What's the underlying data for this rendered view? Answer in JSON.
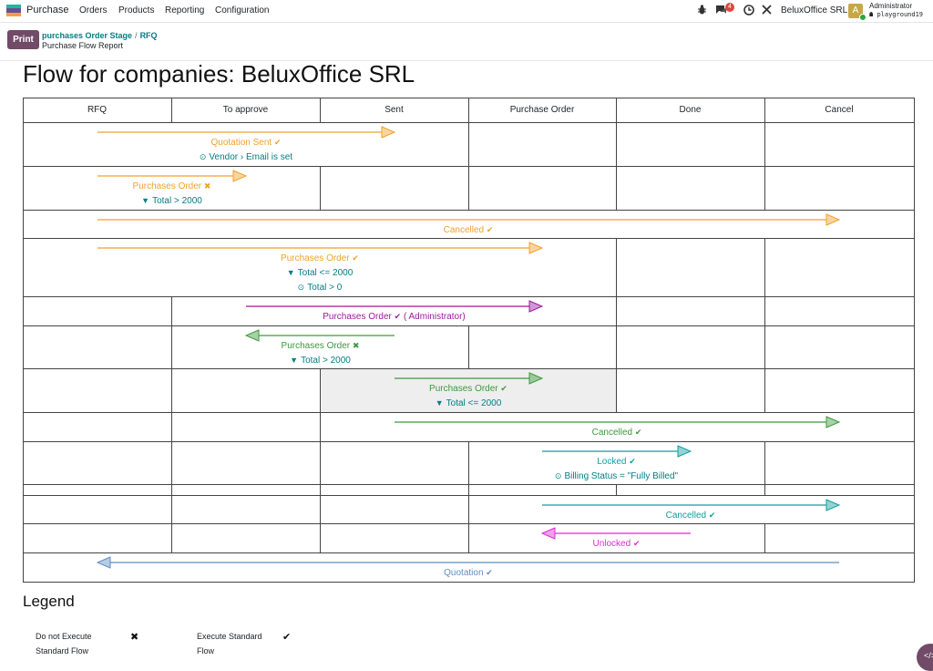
{
  "navbar": {
    "app_name": "Purchase",
    "menu": [
      "Orders",
      "Products",
      "Reporting",
      "Configuration"
    ],
    "message_count": "4",
    "company": "BeluxOffice SRL",
    "user_initial": "A",
    "user_name": "Administrator",
    "database": "playground19"
  },
  "control_panel": {
    "print_label": "Print",
    "breadcrumb": [
      "purchases Order Stage",
      "RFQ"
    ],
    "breadcrumb_sep": "/",
    "subtitle": "Purchase Flow Report"
  },
  "report": {
    "title": "Flow for companies: BeluxOffice SRL",
    "columns": [
      "RFQ",
      "To approve",
      "Sent",
      "Purchase Order",
      "Done",
      "Cancel"
    ],
    "colors": {
      "orange": "#f0a12b",
      "purple": "#9c1a9c",
      "green": "#3c9a3c",
      "teal": "#129e9e",
      "magenta": "#e028d8",
      "blue": "#5b8ec4",
      "cond": "#017e84"
    },
    "flows": [
      {
        "label": "Quotation Sent",
        "mark": "✔",
        "from": "RFQ",
        "to": "Sent",
        "color": "orange",
        "conditions": [
          "Vendor › Email is set"
        ],
        "condition_icons": [
          "check-circle"
        ]
      },
      {
        "label": "Purchases Order",
        "mark": "✖",
        "from": "RFQ",
        "to": "To approve",
        "color": "orange",
        "conditions": [
          "Total > 2000"
        ],
        "condition_icons": [
          "filter"
        ]
      },
      {
        "label": "Cancelled",
        "mark": "✔",
        "from": "RFQ",
        "to": "Cancel",
        "color": "orange",
        "conditions": [],
        "condition_icons": []
      },
      {
        "label": "Purchases Order",
        "mark": "✔",
        "from": "RFQ",
        "to": "Purchase Order",
        "color": "orange",
        "conditions": [
          "Total <= 2000",
          "Total > 0"
        ],
        "condition_icons": [
          "filter",
          "check-circle"
        ]
      },
      {
        "label": "Purchases Order",
        "mark": "✔",
        "suffix": "( Administrator)",
        "from": "To approve",
        "to": "Purchase Order",
        "color": "purple",
        "conditions": [],
        "condition_icons": []
      },
      {
        "label": "Purchases Order",
        "mark": "✖",
        "from": "Sent",
        "to": "To approve",
        "color": "green",
        "conditions": [
          "Total > 2000"
        ],
        "condition_icons": [
          "filter"
        ]
      },
      {
        "label": "Purchases Order",
        "mark": "✔",
        "from": "Sent",
        "to": "Purchase Order",
        "color": "green",
        "conditions": [
          "Total <= 2000"
        ],
        "condition_icons": [
          "filter"
        ]
      },
      {
        "label": "Cancelled",
        "mark": "✔",
        "from": "Sent",
        "to": "Cancel",
        "color": "green",
        "conditions": [],
        "condition_icons": []
      },
      {
        "label": "Locked",
        "mark": "✔",
        "from": "Purchase Order",
        "to": "Done",
        "color": "teal",
        "conditions": [
          "Billing Status = \"Fully Billed\""
        ],
        "condition_icons": [
          "check-circle"
        ]
      },
      {
        "label": "Cancelled",
        "mark": "✔",
        "from": "Purchase Order",
        "to": "Cancel",
        "color": "teal",
        "conditions": [],
        "condition_icons": []
      },
      {
        "label": "Unlocked",
        "mark": "✔",
        "from": "Done",
        "to": "Purchase Order",
        "color": "magenta",
        "conditions": [],
        "condition_icons": []
      },
      {
        "label": "Quotation",
        "mark": "✔",
        "from": "Cancel",
        "to": "RFQ",
        "color": "blue",
        "conditions": [],
        "condition_icons": []
      }
    ]
  },
  "legend": {
    "title": "Legend",
    "items": [
      {
        "line1": "Do not Execute",
        "line2": "Standard Flow",
        "icon": "✖"
      },
      {
        "line1": "Execute Standard",
        "line2": "Flow",
        "icon": "✔"
      }
    ]
  }
}
